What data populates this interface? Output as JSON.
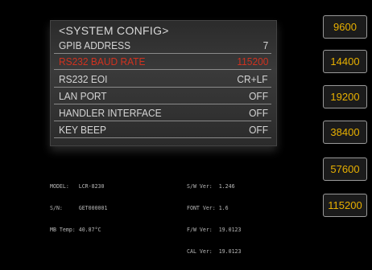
{
  "config_panel": {
    "title": "<SYSTEM CONFIG>",
    "rows": [
      {
        "label": "GPIB ADDRESS",
        "value": "7"
      },
      {
        "label": "RS232 BAUD RATE",
        "value": "115200"
      },
      {
        "label": "RS232 EOI",
        "value": "CR+LF"
      },
      {
        "label": "LAN PORT",
        "value": "OFF"
      },
      {
        "label": "HANDLER INTERFACE",
        "value": "OFF"
      },
      {
        "label": "KEY BEEP",
        "value": "OFF"
      }
    ]
  },
  "device_info": {
    "left": [
      "MODEL:   LCR-8230",
      "S/N:     GET000001",
      "MB Temp: 40.87°C"
    ],
    "right": [
      "S/W Ver:  1.246",
      "FONT Ver: 1.6",
      "F/W Ver:  19.0123",
      "CAL Ver:  19.0123"
    ]
  },
  "softkeys": [
    {
      "label": "9600"
    },
    {
      "label": "14400"
    },
    {
      "label": "19200"
    },
    {
      "label": "38400"
    },
    {
      "label": "57600"
    },
    {
      "label": "115200"
    }
  ],
  "colors": {
    "background": "#000000",
    "selected_row": "#d0321f",
    "softkey_text": "#e8b000"
  }
}
